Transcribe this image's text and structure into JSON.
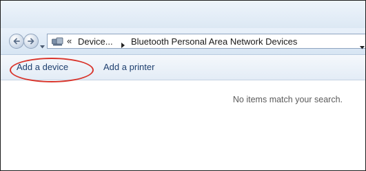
{
  "navigation": {
    "back_icon": "back-arrow-icon",
    "forward_icon": "forward-arrow-icon",
    "history_icon": "dropdown-arrow-icon"
  },
  "address_bar": {
    "location_icon": "devices-and-printers-icon",
    "overflow_chevron": "«",
    "crumbs": [
      "Device...",
      "Bluetooth Personal Area Network Devices"
    ],
    "separator_icon": "breadcrumb-arrow-icon",
    "dropdown_icon": "dropdown-arrow-icon"
  },
  "command_bar": {
    "add_device_label": "Add a device",
    "add_printer_label": "Add a printer"
  },
  "content": {
    "empty_message": "No items match your search."
  },
  "colors": {
    "annotation_circle": "#d9342b",
    "command_text": "#1e3f6e"
  }
}
